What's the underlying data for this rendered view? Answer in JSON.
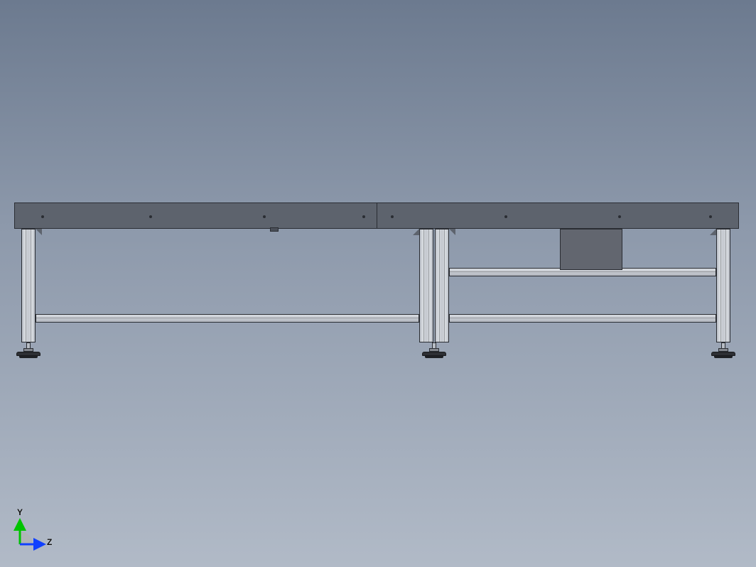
{
  "triad": {
    "axis_y_label": "Y",
    "axis_z_label": "Z",
    "axis_y_color": "#00c400",
    "axis_z_color": "#1040ff",
    "origin_color": "#b0b0b0"
  },
  "model": {
    "kind": "aluminum-extrusion-table-frame",
    "view": "front-orthographic",
    "deck_color": "#5d636d",
    "extrusion_color": "#c4c8cf",
    "deck_segments": 2,
    "legs_count": 4,
    "feet_count": 3
  }
}
